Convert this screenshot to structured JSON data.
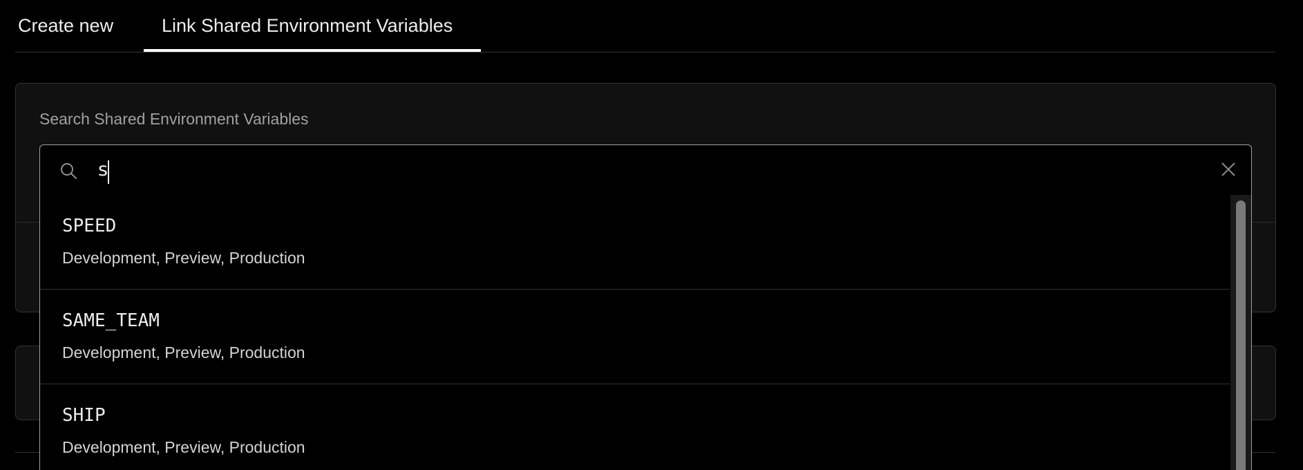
{
  "tabs": [
    {
      "label": "Create new",
      "active": false
    },
    {
      "label": "Link Shared Environment Variables",
      "active": true
    }
  ],
  "search": {
    "label": "Search Shared Environment Variables",
    "value": "s",
    "placeholder": ""
  },
  "results": [
    {
      "name": "SPEED",
      "environments": "Development, Preview, Production"
    },
    {
      "name": "SAME_TEAM",
      "environments": "Development, Preview, Production"
    },
    {
      "name": "SHIP",
      "environments": "Development, Preview, Production"
    }
  ],
  "icons": {
    "search": "search-icon",
    "clear": "close-icon"
  },
  "colors": {
    "background": "#000000",
    "panel": "#111111",
    "text": "#ededed",
    "muted": "#a1a1a1",
    "active_tab_underline": "#ffffff"
  }
}
